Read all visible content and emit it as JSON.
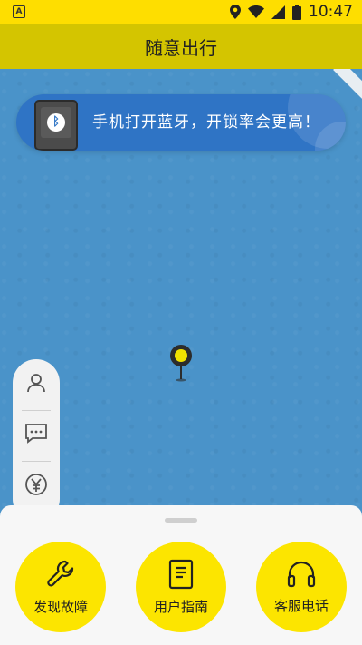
{
  "status_bar": {
    "time": "10:47",
    "left_badge": "A"
  },
  "app_bar": {
    "title": "随意出行"
  },
  "banner": {
    "text": "手机打开蓝牙，开锁率会更高！"
  },
  "side_menu": {
    "items": [
      {
        "icon": "user-icon"
      },
      {
        "icon": "message-icon"
      },
      {
        "icon": "yuan-icon"
      }
    ]
  },
  "actions": [
    {
      "label": "发现故障",
      "icon": "wrench-icon"
    },
    {
      "label": "用户指南",
      "icon": "book-icon"
    },
    {
      "label": "客服电话",
      "icon": "headset-icon"
    }
  ],
  "colors": {
    "status_bar": "#fede00",
    "app_bar": "#d4c500",
    "map": "#4a93c9",
    "banner": "#2f74c5",
    "action_button": "#fce500"
  }
}
